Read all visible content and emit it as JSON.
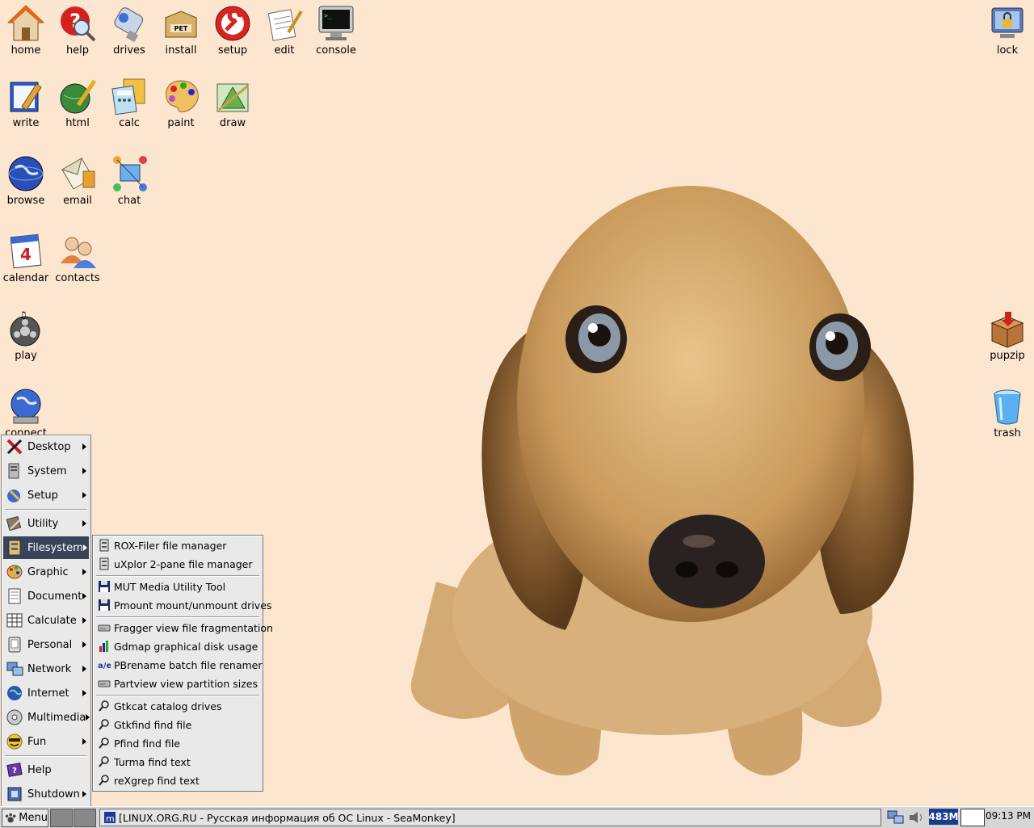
{
  "desktop_icons": {
    "home": "home",
    "help": "help",
    "drives": "drives",
    "install": "install",
    "setup": "setup",
    "edit": "edit",
    "console": "console",
    "lock": "lock",
    "write": "write",
    "html": "html",
    "calc": "calc",
    "paint": "paint",
    "draw": "draw",
    "browse": "browse",
    "email": "email",
    "chat": "chat",
    "calendar": "calendar",
    "contacts": "contacts",
    "play": "play",
    "connect": "connect",
    "pupzip": "pupzip",
    "trash": "trash"
  },
  "main_menu": [
    {
      "label": "Desktop",
      "icon": "desktop-x-icon"
    },
    {
      "label": "System",
      "icon": "system-icon"
    },
    {
      "label": "Setup",
      "icon": "setup-wizard-icon"
    },
    {
      "label": "Utility",
      "icon": "utility-icon"
    },
    {
      "label": "Filesystem",
      "icon": "filesystem-icon",
      "active": true
    },
    {
      "label": "Graphic",
      "icon": "graphic-icon"
    },
    {
      "label": "Document",
      "icon": "document-icon"
    },
    {
      "label": "Calculate",
      "icon": "spreadsheet-icon"
    },
    {
      "label": "Personal",
      "icon": "personal-icon"
    },
    {
      "label": "Network",
      "icon": "network-icon"
    },
    {
      "label": "Internet",
      "icon": "internet-icon"
    },
    {
      "label": "Multimedia",
      "icon": "multimedia-icon"
    },
    {
      "label": "Fun",
      "icon": "fun-icon"
    },
    {
      "label": "Help",
      "icon": "help-book-icon"
    },
    {
      "label": "Shutdown",
      "icon": "shutdown-icon"
    }
  ],
  "filesystem_menu": [
    {
      "label": "ROX-Filer file manager",
      "icon": "file-manager-icon"
    },
    {
      "label": "uXplor 2-pane file manager",
      "icon": "file-manager-icon"
    },
    {
      "label": "MUT Media Utility Tool",
      "icon": "floppy-icon"
    },
    {
      "label": "Pmount mount/unmount drives",
      "icon": "floppy-icon"
    },
    {
      "label": "Fragger view file fragmentation",
      "icon": "drive-icon"
    },
    {
      "label": "Gdmap graphical disk usage",
      "icon": "bar-chart-icon"
    },
    {
      "label": "PBrename batch file renamer",
      "icon": "rename-icon"
    },
    {
      "label": "Partview view partition sizes",
      "icon": "drive-icon"
    },
    {
      "label": "Gtkcat catalog drives",
      "icon": "search-icon"
    },
    {
      "label": "Gtkfind find file",
      "icon": "search-icon"
    },
    {
      "label": "Pfind find file",
      "icon": "search-icon"
    },
    {
      "label": "Turma find text",
      "icon": "search-icon"
    },
    {
      "label": "reXgrep find text",
      "icon": "search-icon"
    }
  ],
  "taskbar": {
    "menu_label": "Menu",
    "task_title": "[LINUX.ORG.RU - Русская информация об ОС Linux - SeaMonkey]",
    "memory": "483M",
    "clock": "09:13 PM"
  }
}
